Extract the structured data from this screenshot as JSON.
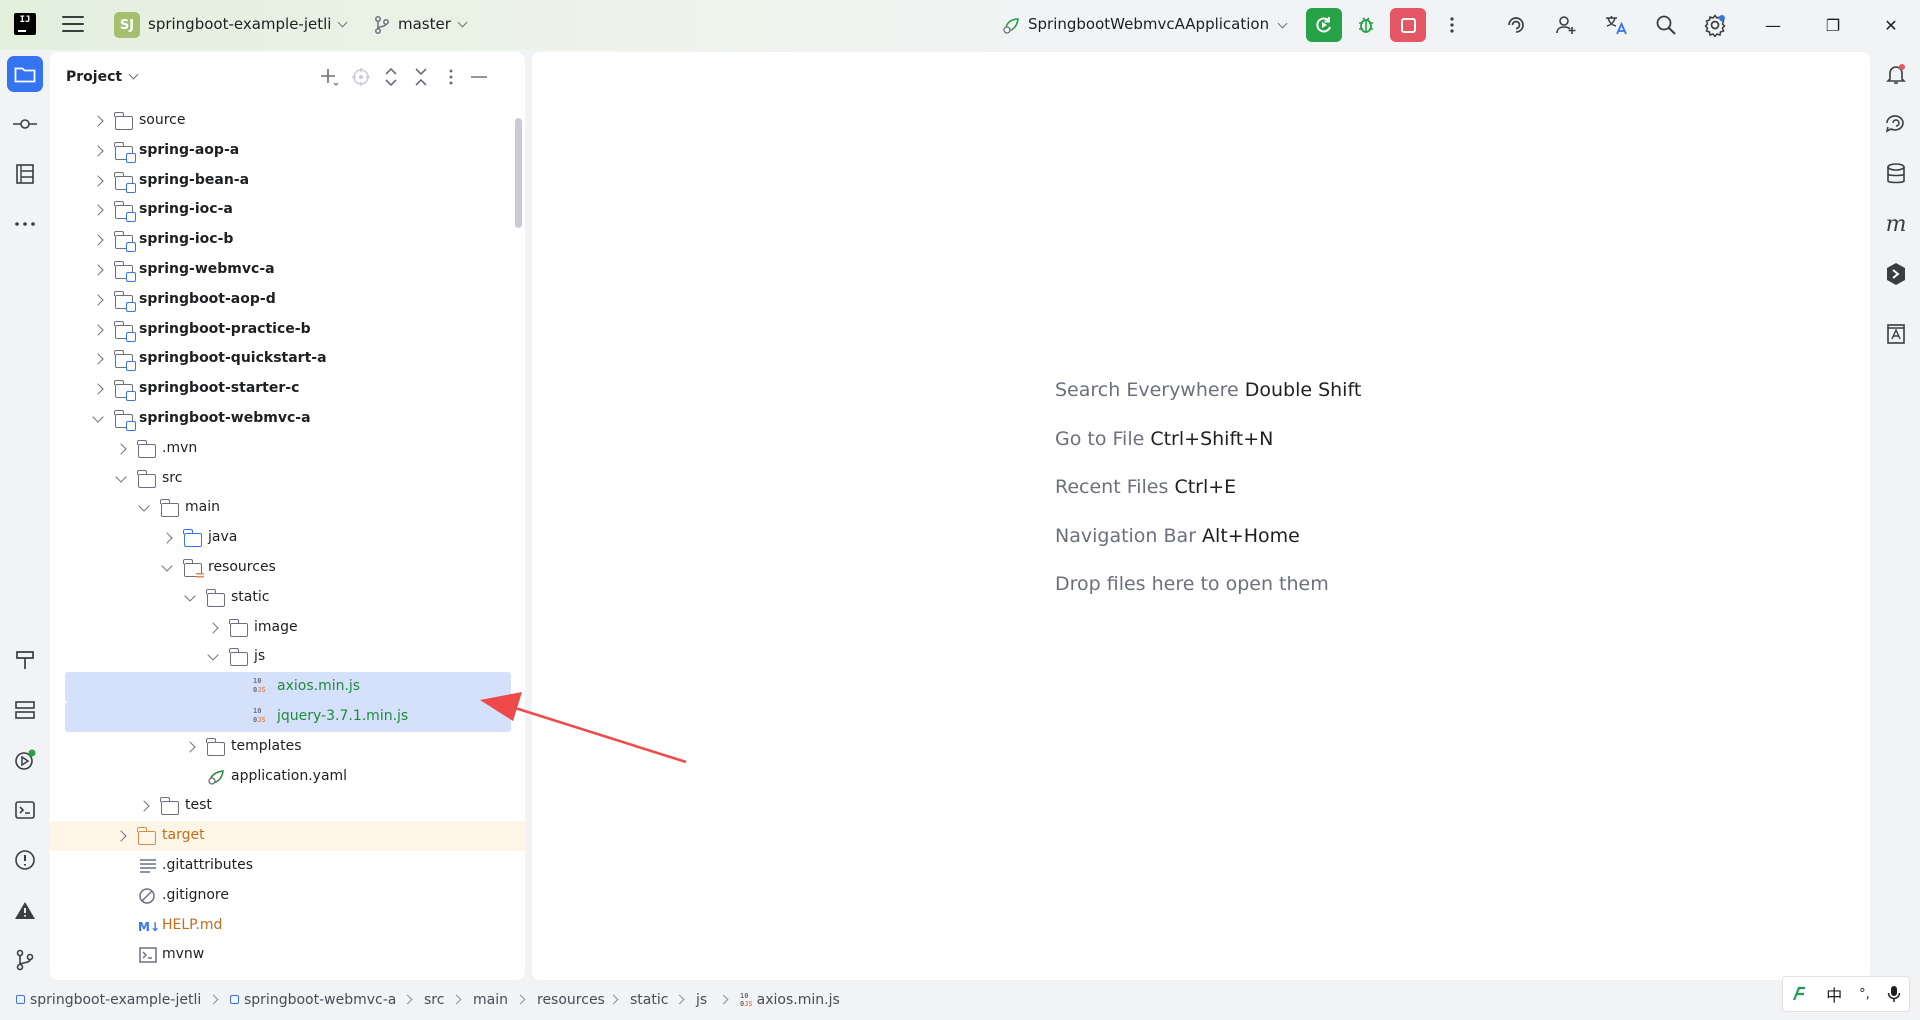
{
  "titlebar": {
    "project_badge": "SJ",
    "project_name": "springboot-example-jetli",
    "branch": "master",
    "run_config": "SpringbootWebmvcAApplication",
    "icons": [
      "hamburger-icon",
      "branch-icon",
      "run-icon",
      "debug-icon",
      "stop-icon",
      "more-icon",
      "ai-assistant-icon",
      "add-user-icon",
      "translate-icon",
      "search-icon",
      "settings-icon"
    ],
    "window_controls": {
      "minimize": "—",
      "restore": "❐",
      "close": "✕"
    }
  },
  "project_panel": {
    "title": "Project",
    "tree": [
      {
        "label": "source",
        "depth": 0,
        "state": "closed",
        "icon": "folder",
        "bold": false
      },
      {
        "label": "spring-aop-a",
        "depth": 0,
        "state": "closed",
        "icon": "module",
        "bold": true
      },
      {
        "label": "spring-bean-a",
        "depth": 0,
        "state": "closed",
        "icon": "module",
        "bold": true
      },
      {
        "label": "spring-ioc-a",
        "depth": 0,
        "state": "closed",
        "icon": "module",
        "bold": true
      },
      {
        "label": "spring-ioc-b",
        "depth": 0,
        "state": "closed",
        "icon": "module",
        "bold": true
      },
      {
        "label": "spring-webmvc-a",
        "depth": 0,
        "state": "closed",
        "icon": "module",
        "bold": true
      },
      {
        "label": "springboot-aop-d",
        "depth": 0,
        "state": "closed",
        "icon": "module",
        "bold": true
      },
      {
        "label": "springboot-practice-b",
        "depth": 0,
        "state": "closed",
        "icon": "module",
        "bold": true
      },
      {
        "label": "springboot-quickstart-a",
        "depth": 0,
        "state": "closed",
        "icon": "module",
        "bold": true
      },
      {
        "label": "springboot-starter-c",
        "depth": 0,
        "state": "closed",
        "icon": "module",
        "bold": true
      },
      {
        "label": "springboot-webmvc-a",
        "depth": 0,
        "state": "open",
        "icon": "module",
        "bold": true
      },
      {
        "label": ".mvn",
        "depth": 1,
        "state": "closed",
        "icon": "folder",
        "bold": false
      },
      {
        "label": "src",
        "depth": 1,
        "state": "open",
        "icon": "folder",
        "bold": false
      },
      {
        "label": "main",
        "depth": 2,
        "state": "open",
        "icon": "folder",
        "bold": false
      },
      {
        "label": "java",
        "depth": 3,
        "state": "closed",
        "icon": "src",
        "bold": false
      },
      {
        "label": "resources",
        "depth": 3,
        "state": "open",
        "icon": "res",
        "bold": false
      },
      {
        "label": "static",
        "depth": 4,
        "state": "open",
        "icon": "folder",
        "bold": false
      },
      {
        "label": "image",
        "depth": 5,
        "state": "closed",
        "icon": "folder",
        "bold": false
      },
      {
        "label": "js",
        "depth": 5,
        "state": "open",
        "icon": "folder",
        "bold": false
      },
      {
        "label": "axios.min.js",
        "depth": 6,
        "state": "none",
        "icon": "js",
        "bold": false,
        "color": "green",
        "selected": true
      },
      {
        "label": "jquery-3.7.1.min.js",
        "depth": 6,
        "state": "none",
        "icon": "js",
        "bold": false,
        "color": "green",
        "selected": true
      },
      {
        "label": "templates",
        "depth": 4,
        "state": "closed",
        "icon": "folder",
        "bold": false
      },
      {
        "label": "application.yaml",
        "depth": 4,
        "state": "none",
        "icon": "yaml",
        "bold": false
      },
      {
        "label": "test",
        "depth": 2,
        "state": "closed",
        "icon": "folder",
        "bold": false
      },
      {
        "label": "target",
        "depth": 1,
        "state": "closed",
        "icon": "target",
        "bold": false,
        "color": "orange",
        "highlight": true
      },
      {
        "label": ".gitattributes",
        "depth": 1,
        "state": "none",
        "icon": "text",
        "bold": false
      },
      {
        "label": ".gitignore",
        "depth": 1,
        "state": "none",
        "icon": "ignore",
        "bold": false
      },
      {
        "label": "HELP.md",
        "depth": 1,
        "state": "none",
        "icon": "md",
        "bold": false,
        "color": "orange"
      },
      {
        "label": "mvnw",
        "depth": 1,
        "state": "none",
        "icon": "shell",
        "bold": false
      }
    ]
  },
  "editor": {
    "hints": [
      {
        "text": "Search Everywhere",
        "key": "Double Shift"
      },
      {
        "text": "Go to File",
        "key": "Ctrl+Shift+N"
      },
      {
        "text": "Recent Files",
        "key": "Ctrl+E"
      },
      {
        "text": "Navigation Bar",
        "key": "Alt+Home"
      },
      {
        "text": "Drop files here to open them",
        "key": ""
      }
    ]
  },
  "statusbar": {
    "breadcrumbs": [
      "springboot-example-jetli",
      "springboot-webmvc-a",
      "src",
      "main",
      "resources",
      "static",
      "js",
      "axios.min.js"
    ]
  },
  "ime": {
    "lang": "中",
    "punct": "°,"
  },
  "colors": {
    "accent": "#3574f0",
    "run": "#27a347",
    "stop": "#e55765",
    "selection": "#d5e1fb",
    "file_green": "#1f8a3a",
    "excluded_orange": "#c06d1f",
    "annotation_arrow": "#ef4a4a"
  }
}
